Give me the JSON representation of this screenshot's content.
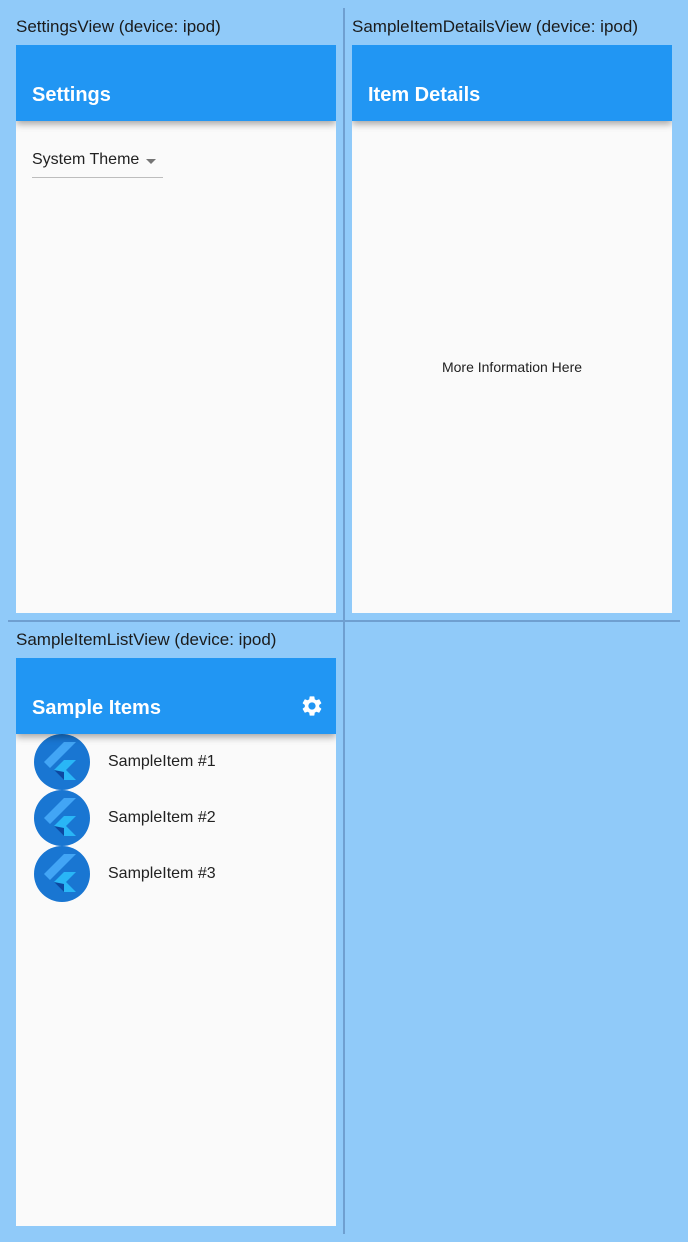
{
  "views": {
    "settings": {
      "label": "SettingsView (device: ipod)",
      "title": "Settings",
      "theme_dropdown": {
        "selected": "System Theme"
      }
    },
    "details": {
      "label": "SampleItemDetailsView (device: ipod)",
      "title": "Item Details",
      "body_text": "More Information Here"
    },
    "list": {
      "label": "SampleItemListView (device: ipod)",
      "title": "Sample Items",
      "settings_icon": "gear-icon",
      "items": [
        {
          "label": "SampleItem #1",
          "icon": "flutter-logo-icon"
        },
        {
          "label": "SampleItem #2",
          "icon": "flutter-logo-icon"
        },
        {
          "label": "SampleItem #3",
          "icon": "flutter-logo-icon"
        }
      ]
    }
  },
  "colors": {
    "background": "#90caf9",
    "app_bar": "#2196f3",
    "screen": "#fafafa"
  }
}
